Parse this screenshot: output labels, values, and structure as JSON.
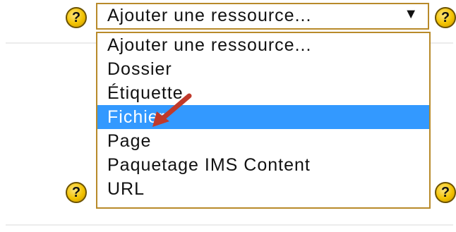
{
  "select": {
    "value": "Ajouter une ressource...",
    "arrow_icon": "triangle-down-icon",
    "options": [
      "Ajouter une ressource...",
      "Dossier",
      "Étiquette",
      "Fichier",
      "Page",
      "Paquetage IMS Content",
      "URL"
    ],
    "selected_option": "Fichier",
    "highlight_color": "#3399ff",
    "border_color": "#b88a2a"
  },
  "help": {
    "glyph": "?",
    "icon": "help-icon",
    "color": "#f2c200"
  },
  "arrow_glyph": "▼"
}
